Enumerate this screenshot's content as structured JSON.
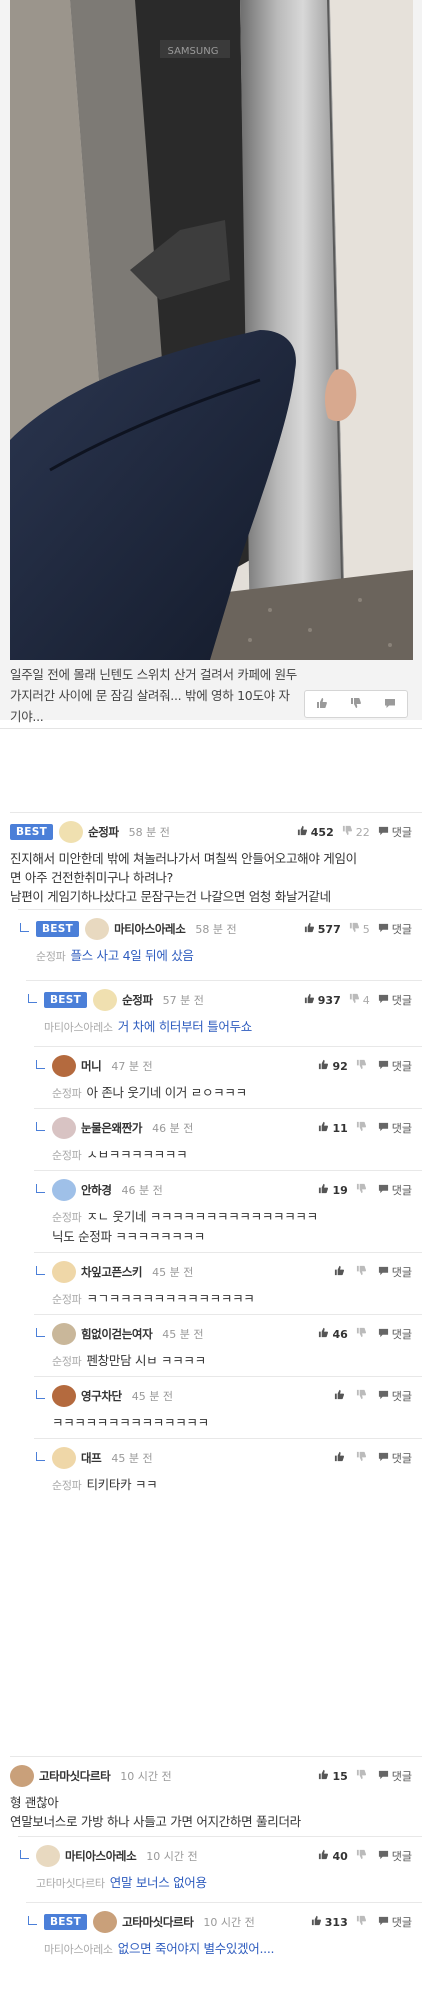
{
  "post": {
    "caption": "일주일 전에 몰래 닌텐도 스위치 산거 걸려서  카페에 원두 가지러간 사이에 문 잠김 살려줘... 밖에 영하 10도야 자기야...",
    "photo_brand": "SAMSUNG",
    "actions": [
      "thumbs-up-icon",
      "thumbs-down-icon",
      "comment-icon"
    ]
  },
  "labels": {
    "best": "BEST",
    "reply": "댓글"
  },
  "comments": [
    {
      "nick": "순정파",
      "time": "58 분 전",
      "likes": "452",
      "dislikes": "22",
      "best": true,
      "lines": [
        "진지해서 미안한데 밖에 쳐놀러나가서 며칠씩 안들어오고해야 게임이",
        "면 아주 건전한취미구나 하려나?",
        "남편이 게임기하나샀다고 문잠구는건 나갈으면 엄청 화날거같네"
      ]
    },
    {
      "nick": "마티아스아레소",
      "time": "58 분 전",
      "likes": "577",
      "dislikes": "5",
      "best": true,
      "mention": "순정파",
      "lines": [
        "플스 사고 4일 뒤에 샀음"
      ]
    },
    {
      "nick": "순정파",
      "time": "57 분 전",
      "likes": "937",
      "dislikes": "4",
      "best": true,
      "mention": "마티아스아레소",
      "lines": [
        "거 차에 히터부터 틀어두쇼"
      ]
    },
    {
      "nick": "머니",
      "time": "47 분 전",
      "likes": "92",
      "dislikes": "",
      "mention": "순정파",
      "lines": [
        "아 존나 웃기네 이거 ㄹㅇㅋㅋㅋ"
      ]
    },
    {
      "nick": "눈물은왜짠가",
      "time": "46 분 전",
      "likes": "11",
      "dislikes": "",
      "mention": "순정파",
      "lines": [
        "ㅅㅂㅋㅋㅋㅋㅋㅋㅋ"
      ]
    },
    {
      "nick": "안하경",
      "time": "46 분 전",
      "likes": "19",
      "dislikes": "",
      "mention": "순정파",
      "lines": [
        "ㅈㄴ 웃기네 ㅋㅋㅋㅋㅋㅋㅋㅋㅋㅋㅋㅋㅋㅋㅋ",
        "닉도 순정파 ㅋㅋㅋㅋㅋㅋㅋㅋ"
      ]
    },
    {
      "nick": "차잎고픈스키",
      "time": "45 분 전",
      "likes": "",
      "dislikes": "",
      "mention": "순정파",
      "lines": [
        "ㅋㄱㅋㅋㅋㅋㅋㅋㅋㅋㅋㅋㅋㅋㅋ"
      ]
    },
    {
      "nick": "힘없이걷는여자",
      "time": "45 분 전",
      "likes": "46",
      "dislikes": "",
      "mention": "순정파",
      "lines": [
        "펜창만담 시ㅂ ㅋㅋㅋㅋ"
      ]
    },
    {
      "nick": "영구차단",
      "time": "45 분 전",
      "likes": "",
      "dislikes": "",
      "lines": [
        "ㅋㅋㅋㅋㅋㅋㅋㅋㅋㅋㅋㅋㅋㅋ"
      ]
    },
    {
      "nick": "대프",
      "time": "45 분 전",
      "likes": "",
      "dislikes": "",
      "mention": "순정파",
      "lines": [
        "티키타카 ㅋㅋ"
      ]
    },
    {
      "nick": "고타마싯다르타",
      "time": "10 시간 전",
      "likes": "15",
      "dislikes": "",
      "lines": [
        "형 괜찮아",
        "연말보너스로 가방 하나 사들고 가면 어지간하면 풀리더라"
      ]
    },
    {
      "nick": "마티아스아레소",
      "time": "10 시간 전",
      "likes": "40",
      "dislikes": "",
      "mention": "고타마싯다르타",
      "lines": [
        "연말 보너스 없어용"
      ]
    },
    {
      "nick": "고타마싯다르타",
      "time": "10 시간 전",
      "likes": "313",
      "dislikes": "",
      "best": true,
      "mention": "마티아스아레소",
      "lines": [
        "없으면 죽어야지 별수있겠어...."
      ]
    }
  ],
  "colors": {
    "best_badge": "#4b7fd8",
    "mention_link": "#2f5dbf",
    "coat": "#1f2a3f",
    "wall": "#e2ddd5"
  }
}
